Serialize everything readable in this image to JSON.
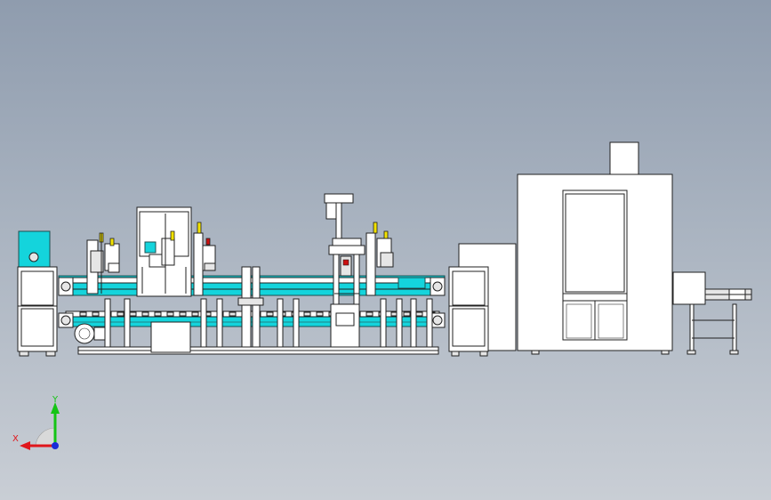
{
  "scene": {
    "description_free": true,
    "colors": {
      "line": "#202020",
      "frame_fill": "#ffffff",
      "cyan_part": "#14d4dc",
      "cyan_dark": "#0aa9b0",
      "panel_gray": "#e6e6e6",
      "yellow": "#f2e200",
      "red": "#cc1010"
    }
  },
  "triad": {
    "x_label": "X",
    "y_label": "Y",
    "x_color": "#e0161b",
    "y_color": "#14c414",
    "z_color": "#1a2bd8"
  }
}
